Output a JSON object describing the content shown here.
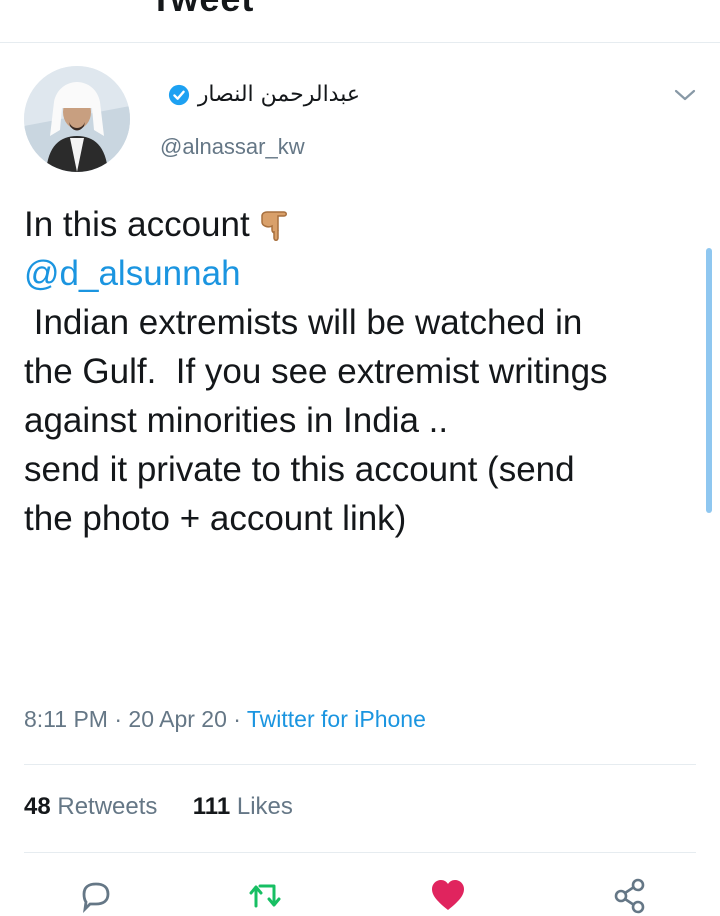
{
  "header": {
    "title": "Tweet"
  },
  "tweet": {
    "display_name": "عبدالرحمن النصار",
    "handle": "@alnassar_kw",
    "lines": [
      "In this account",
      "",
      "@d_alsunnah",
      "",
      " Indian extremists will be watched in",
      "the Gulf.  If you see extremist writings",
      "against minorities in India ..",
      "",
      "send it private to this account (send",
      "the photo + account link)"
    ],
    "time": "8:11 PM",
    "date": "20 Apr 20",
    "source": "Twitter for iPhone",
    "retweets_count": "48",
    "retweets_label": "Retweets",
    "likes_count": "111",
    "likes_label": "Likes"
  },
  "colors": {
    "accent": "#1da1f2",
    "link": "#1b95e0",
    "retweet": "#17bf63",
    "like": "#e0245e",
    "muted": "#657786"
  },
  "icons": [
    "back-icon",
    "verified-icon",
    "chevron-down-icon",
    "pointing-hand-icon",
    "reply-icon",
    "retweet-icon",
    "like-icon",
    "share-icon"
  ]
}
